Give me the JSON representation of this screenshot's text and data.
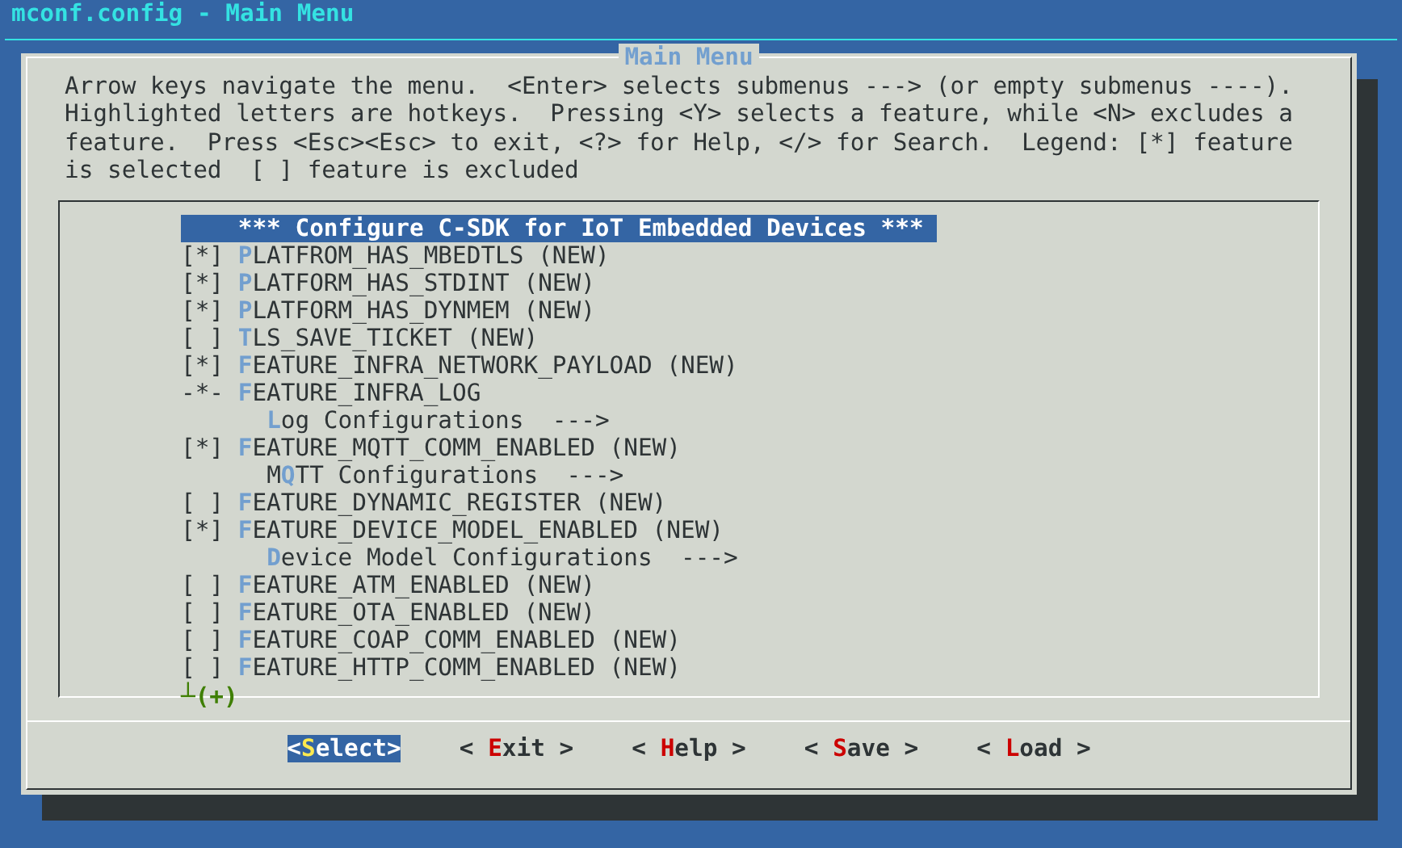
{
  "window": {
    "title": "mconf.config - Main Menu"
  },
  "dialog": {
    "title": "Main Menu",
    "help_lines": [
      "Arrow keys navigate the menu.  <Enter> selects submenus ---> (or empty submenus ----).",
      "Highlighted letters are hotkeys.  Pressing <Y> selects a feature, while <N> excludes a",
      "feature.  Press <Esc><Esc> to exit, <?> for Help, </> for Search.  Legend: [*] feature",
      "is selected  [ ] feature is excluded"
    ],
    "items": [
      {
        "kind": "header",
        "start": "*** Configure C-SDK for IoT Embedded Devices ***",
        "selected": true
      },
      {
        "kind": "option",
        "prefix": "[*]",
        "hotkey": "P",
        "end": "LATFROM_HAS_MBEDTLS (NEW)",
        "selected": false
      },
      {
        "kind": "option",
        "prefix": "[*]",
        "hotkey": "P",
        "end": "LATFORM_HAS_STDINT (NEW)",
        "selected": false
      },
      {
        "kind": "option",
        "prefix": "[*]",
        "hotkey": "P",
        "end": "LATFORM_HAS_DYNMEM (NEW)",
        "selected": false
      },
      {
        "kind": "option",
        "prefix": "[ ]",
        "hotkey": "T",
        "end": "LS_SAVE_TICKET (NEW)",
        "selected": false
      },
      {
        "kind": "option",
        "prefix": "[*]",
        "hotkey": "F",
        "end": "EATURE_INFRA_NETWORK_PAYLOAD (NEW)",
        "selected": false
      },
      {
        "kind": "option",
        "prefix": "-*-",
        "hotkey": "F",
        "end": "EATURE_INFRA_LOG",
        "selected": false
      },
      {
        "kind": "submenu",
        "hotkey": "L",
        "end": "og Configurations  --->",
        "selected": false
      },
      {
        "kind": "option",
        "prefix": "[*]",
        "hotkey": "F",
        "end": "EATURE_MQTT_COMM_ENABLED (NEW)",
        "selected": false
      },
      {
        "kind": "submenu",
        "start": "M",
        "hotkey": "Q",
        "end": "TT Configurations  --->",
        "selected": false
      },
      {
        "kind": "option",
        "prefix": "[ ]",
        "hotkey": "F",
        "end": "EATURE_DYNAMIC_REGISTER (NEW)",
        "selected": false
      },
      {
        "kind": "option",
        "prefix": "[*]",
        "hotkey": "F",
        "end": "EATURE_DEVICE_MODEL_ENABLED (NEW)",
        "selected": false
      },
      {
        "kind": "submenu",
        "hotkey": "D",
        "end": "evice Model Configurations  --->",
        "selected": false
      },
      {
        "kind": "option",
        "prefix": "[ ]",
        "hotkey": "F",
        "end": "EATURE_ATM_ENABLED (NEW)",
        "selected": false
      },
      {
        "kind": "option",
        "prefix": "[ ]",
        "hotkey": "F",
        "end": "EATURE_OTA_ENABLED (NEW)",
        "selected": false
      },
      {
        "kind": "option",
        "prefix": "[ ]",
        "hotkey": "F",
        "end": "EATURE_COAP_COMM_ENABLED (NEW)",
        "selected": false
      },
      {
        "kind": "option",
        "prefix": "[ ]",
        "hotkey": "F",
        "end": "EATURE_HTTP_COMM_ENABLED (NEW)",
        "selected": false
      }
    ],
    "more_indicator": "┴(+)",
    "buttons": [
      {
        "start": "<",
        "hotkey": "S",
        "end": "elect>",
        "selected": true
      },
      {
        "start": "< ",
        "hotkey": "E",
        "end": "xit >",
        "selected": false
      },
      {
        "start": "< ",
        "hotkey": "H",
        "end": "elp >",
        "selected": false
      },
      {
        "start": "< ",
        "hotkey": "S",
        "end": "ave >",
        "selected": false
      },
      {
        "start": "< ",
        "hotkey": "L",
        "end": "oad >",
        "selected": false
      }
    ]
  }
}
